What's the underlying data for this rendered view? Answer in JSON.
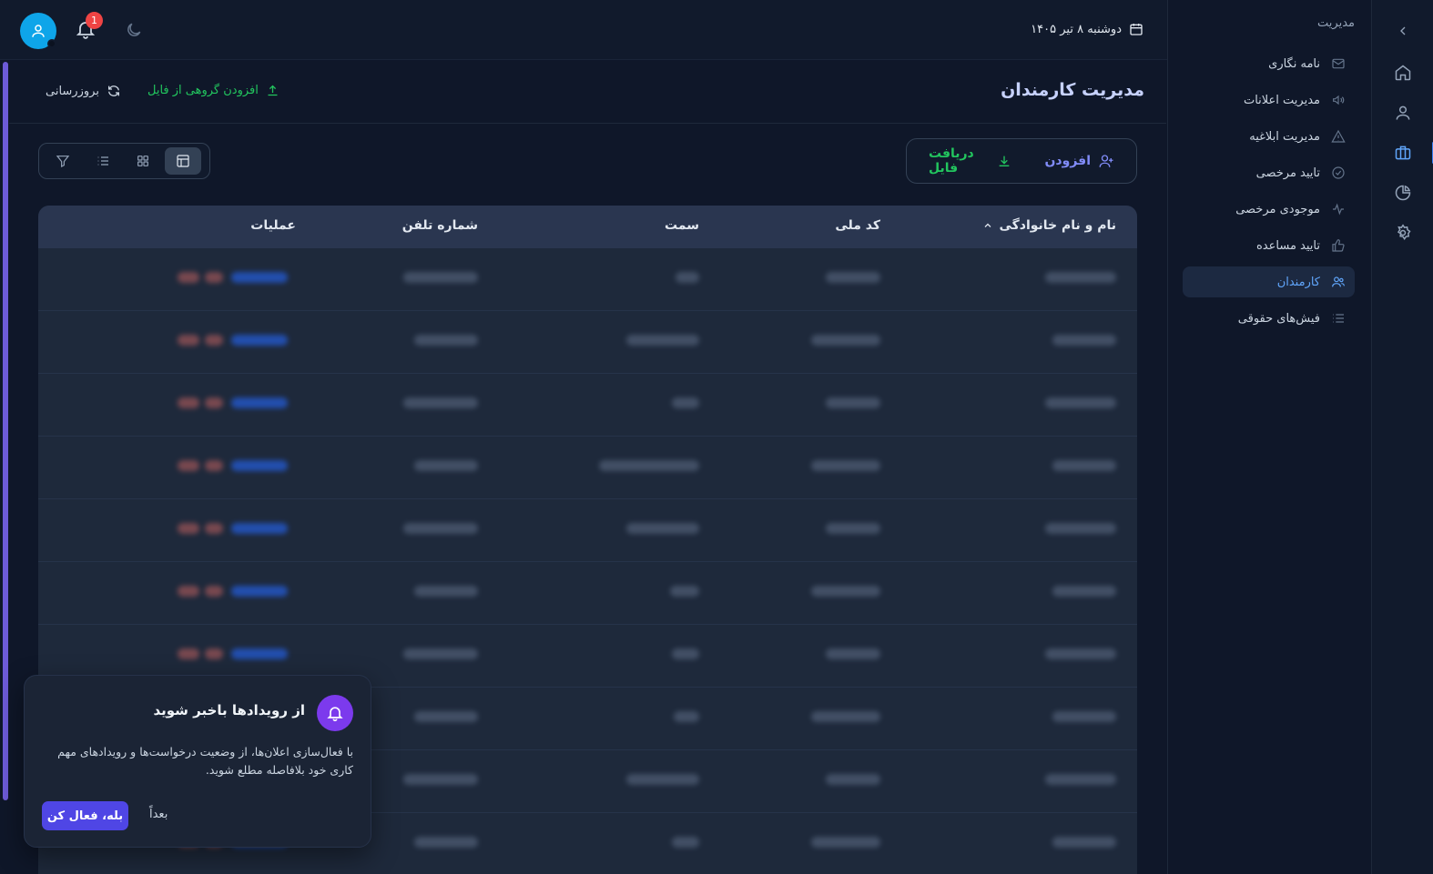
{
  "topbar": {
    "date": "دوشنبه ۸ تیر ۱۴۰۵",
    "notification_count": "1"
  },
  "sidebar": {
    "section_title": "مدیریت",
    "items": [
      {
        "label": "نامه نگاری",
        "icon": "mail-icon"
      },
      {
        "label": "مدیریت اعلانات",
        "icon": "megaphone-icon"
      },
      {
        "label": "مدیریت ابلاغیه",
        "icon": "warning-icon"
      },
      {
        "label": "تایید مرخصی",
        "icon": "check-circle-icon"
      },
      {
        "label": "موجودی مرخصی",
        "icon": "activity-icon"
      },
      {
        "label": "تایید مساعده",
        "icon": "thumbs-up-icon"
      },
      {
        "label": "کارمندان",
        "icon": "users-icon",
        "active": true
      },
      {
        "label": "فیش‌های حقوقی",
        "icon": "list-icon"
      }
    ]
  },
  "rail": {
    "icons": [
      "chevron-left-icon",
      "home-icon",
      "user-icon",
      "briefcase-icon",
      "pie-chart-icon",
      "settings-icon"
    ],
    "active": "briefcase-icon"
  },
  "page": {
    "title": "مدیریت کارمندان",
    "upload_label": "افزودن گروهی از فایل",
    "refresh_label": "بروزرسانی",
    "add_label": "افزودن",
    "download_label": "دریافت فایل"
  },
  "view_modes": {
    "active": "table-icon",
    "icons": [
      "table-icon",
      "grid-icon",
      "list-icon",
      "filter-icon"
    ]
  },
  "table": {
    "columns": [
      "نام و نام خانوادگی",
      "کد ملی",
      "سمت",
      "شماره تلفن",
      "عملیات"
    ],
    "sorted_column": "نام و نام خانوادگی",
    "row_count": 10
  },
  "toast": {
    "title": "از رویدادها باخبر شوید",
    "body": "با فعال‌سازی اعلان‌ها، از وضعیت درخواست‌ها و رویدادهای مهم کاری خود بلافاصله مطلع شوید.",
    "confirm_label": "بله، فعال کن",
    "later_label": "بعداً"
  },
  "colors": {
    "accent": "#3b82f6",
    "success": "#22c55e",
    "primary_button": "#4f46e5",
    "badge": "#ef4444"
  }
}
